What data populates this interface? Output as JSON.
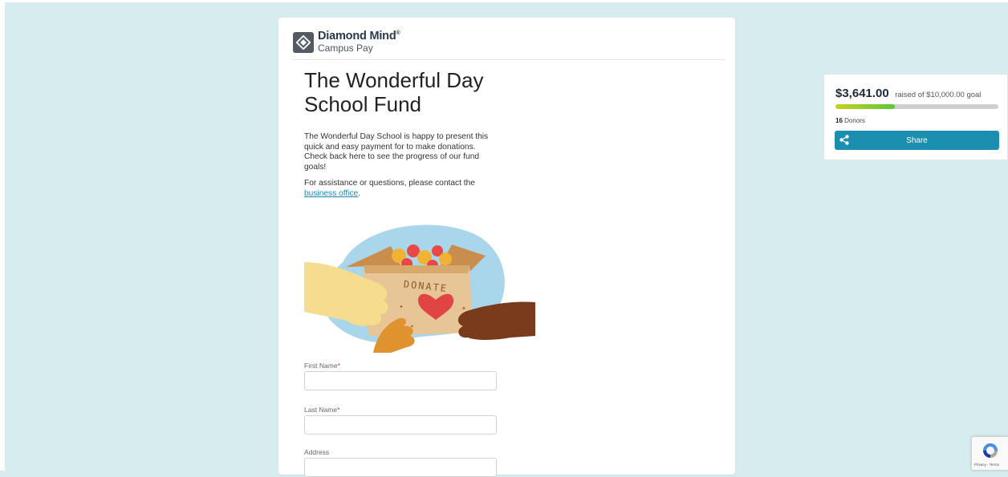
{
  "brand": {
    "name": "Diamond Mind",
    "trademark": "®",
    "sub": "Campus Pay"
  },
  "fund": {
    "title": "The Wonderful Day School Fund",
    "description": "The Wonderful Day School is happy to present this quick and easy payment for to make donations. Check back here to see the progress of our fund goals!",
    "contact_prefix": "For assistance or questions, please contact the ",
    "contact_link": "business office",
    "contact_suffix": "."
  },
  "illustration": {
    "box_text": "DONATE"
  },
  "form": {
    "fields": [
      {
        "label": "First Name",
        "required_mark": "*",
        "value": ""
      },
      {
        "label": "Last Name",
        "required_mark": "*",
        "value": ""
      },
      {
        "label": "Address",
        "value": ""
      }
    ]
  },
  "goal": {
    "raised": "$3,641.00",
    "raised_of": "raised of $10,000.00 goal",
    "progress_fraction": 0.3641,
    "donor_count": "16",
    "donor_label": "Donors",
    "share_label": "Share"
  },
  "recaptcha": {
    "links": "Privacy - Terms"
  },
  "colors": {
    "background": "#d6ecee",
    "accent": "#1a8fb0",
    "progress_start": "#c7d41c",
    "progress_end": "#5cc53a",
    "required": "#c0392b"
  },
  "icons": {
    "logo": "diamond-logo-icon",
    "share": "share-icon",
    "heart": "heart-icon",
    "recaptcha": "recaptcha-icon"
  }
}
